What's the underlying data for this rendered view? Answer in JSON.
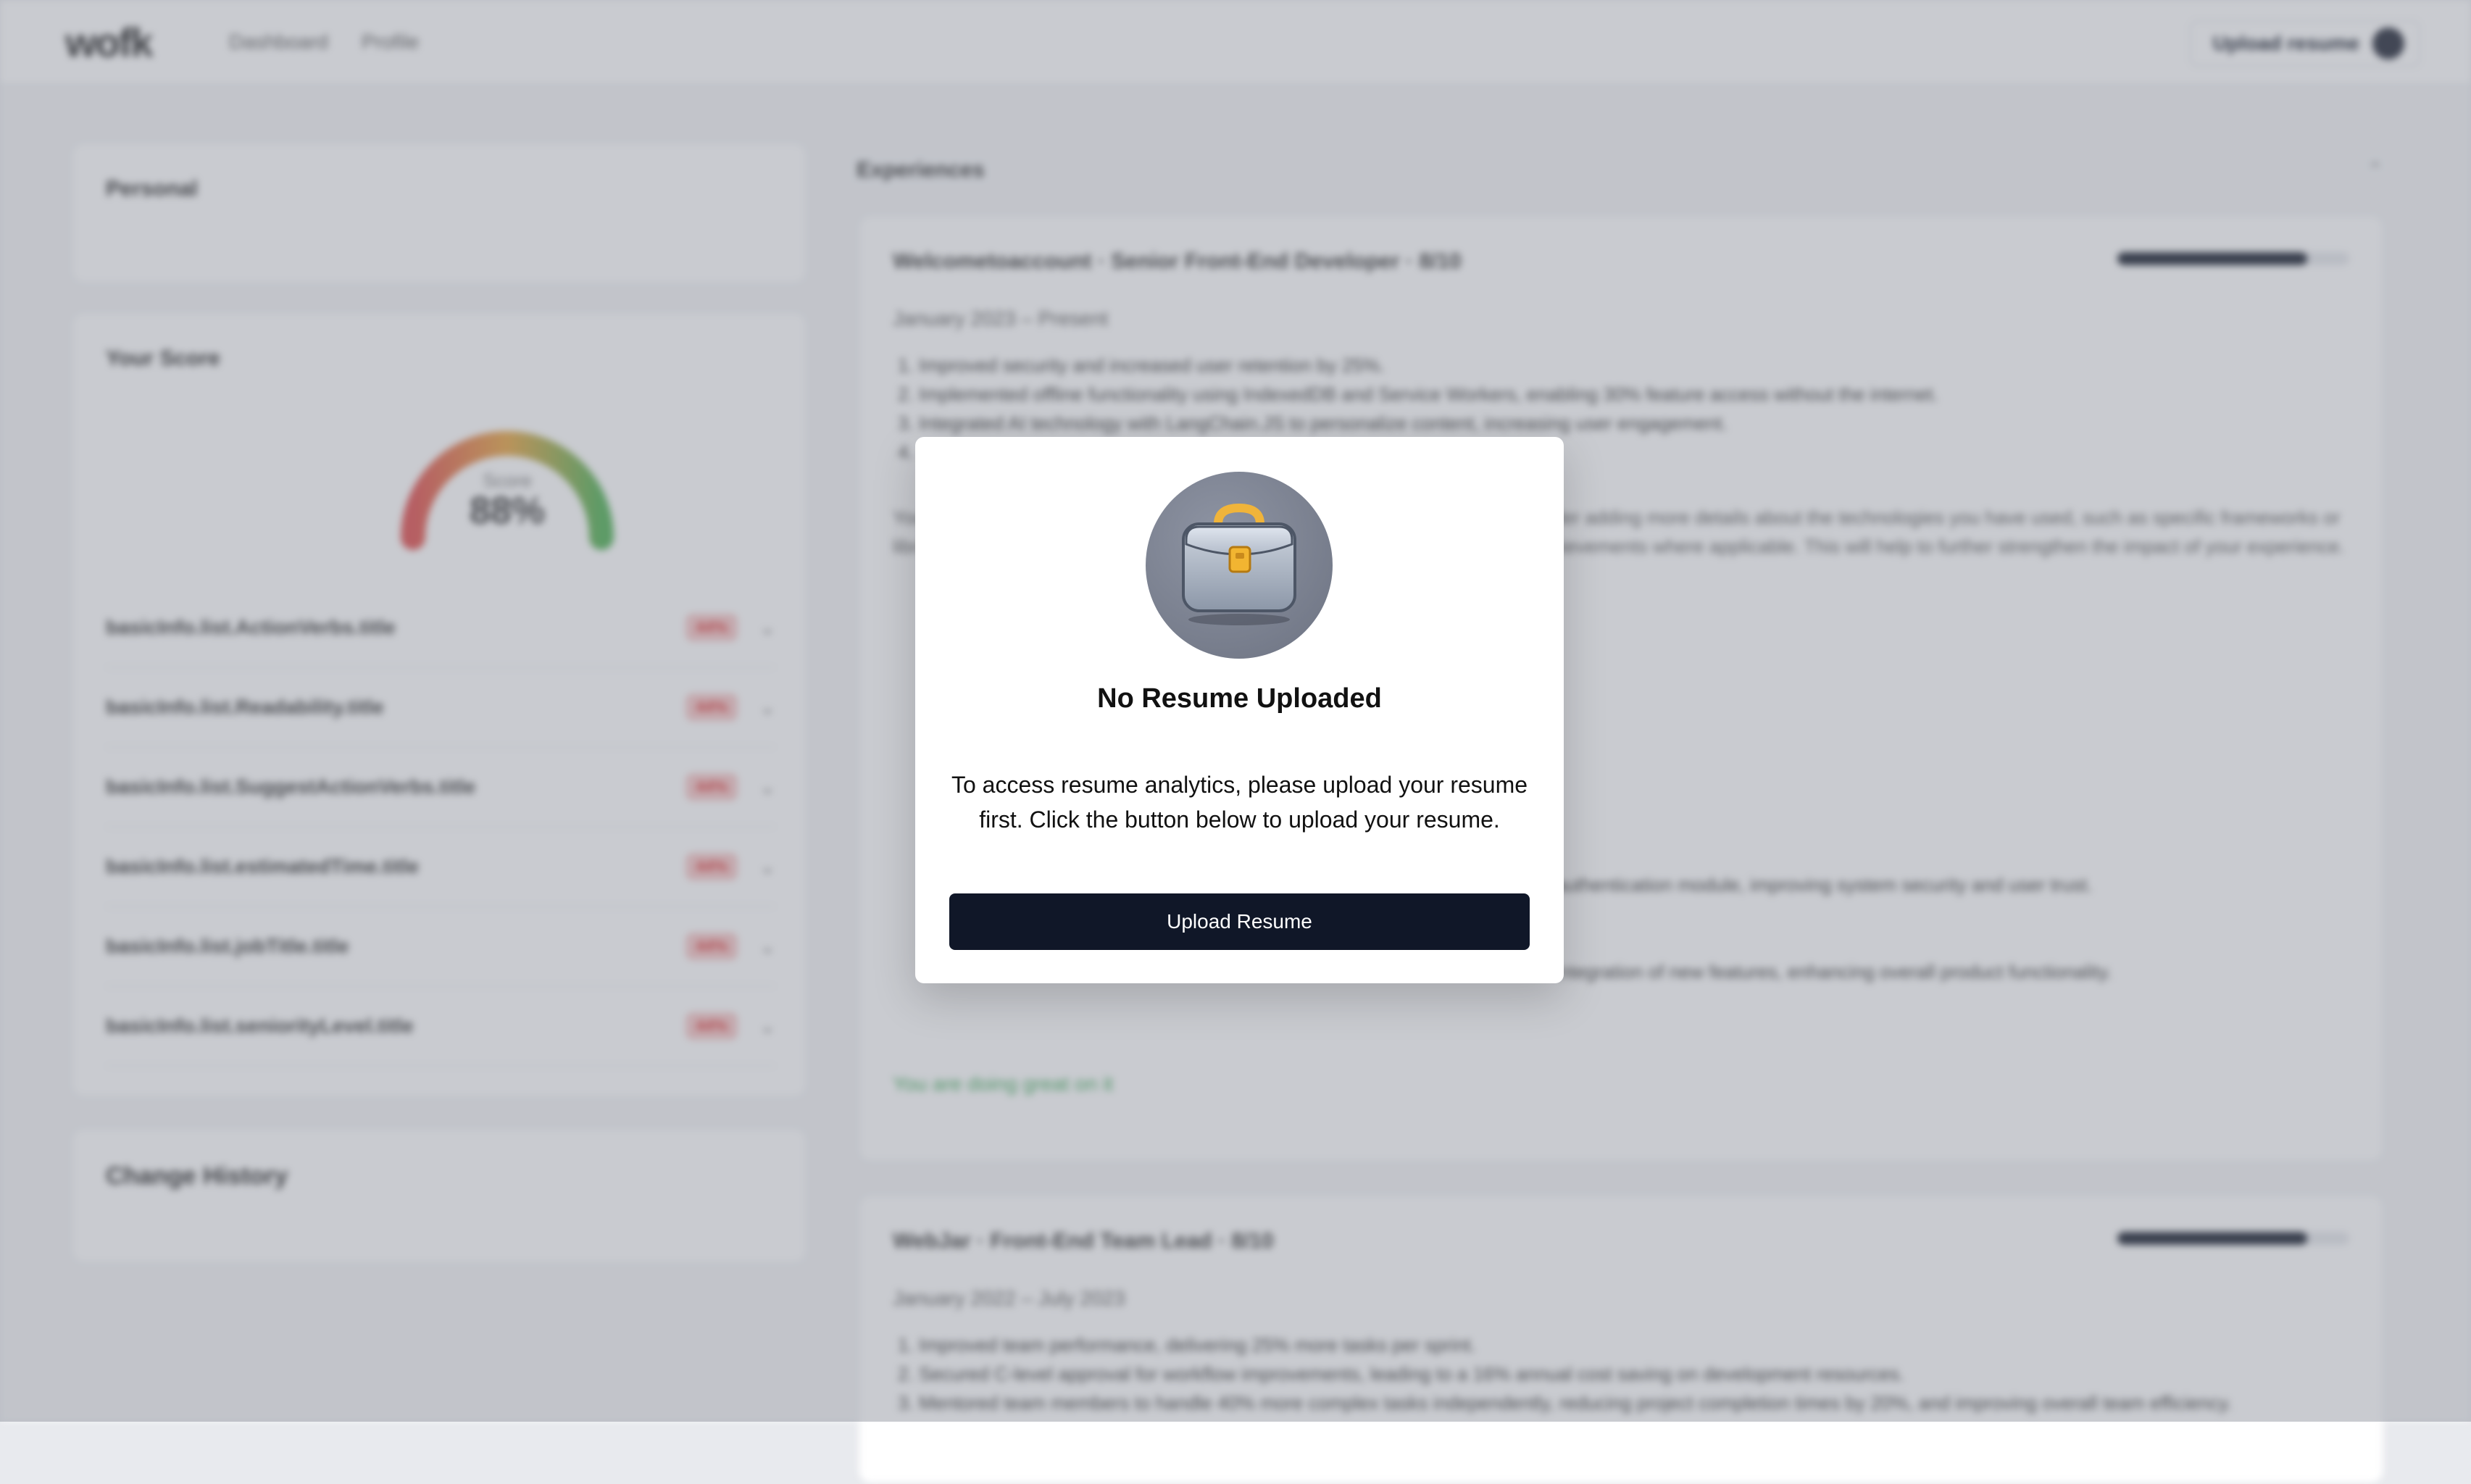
{
  "header": {
    "logo": "wofk",
    "nav": [
      "Dashboard",
      "Profile"
    ],
    "upload_label": "Upload resume"
  },
  "left": {
    "personal_title": "Personal",
    "score_title": "Your Score",
    "gauge_label": "Score",
    "gauge_value": "88%",
    "score_rows": [
      {
        "name": "basicInfo.list.ActionVerbs.title",
        "badge": "44%"
      },
      {
        "name": "basicInfo.list.Readability.title",
        "badge": "44%"
      },
      {
        "name": "basicInfo.list.SuggestActionVerbs.title",
        "badge": "44%"
      },
      {
        "name": "basicInfo.list.estimatedTime.title",
        "badge": "44%"
      },
      {
        "name": "basicInfo.list.jobTitle.title",
        "badge": "44%"
      },
      {
        "name": "basicInfo.list.seniorityLevel.title",
        "badge": "44%"
      }
    ],
    "history_title": "Change History"
  },
  "experiences": {
    "heading": "Experiences",
    "items": [
      {
        "title": "Welcometoaccount · Senior Front-End Developer · 8/10",
        "dates": "January 2023 – Present",
        "progress": 0.82,
        "bullets": [
          "Improved security and increased user retention by 25%.",
          "Implemented offline functionality using IndexedDB and Service Workers, enabling 30% feature access without the internet.",
          "Integrated AI technology with LangChain.JS to personalize content, increasing user engagement.",
          "..."
        ],
        "feedback": "Your experience is strong and highly relevant. To achieve a perfect score, consider adding more details about the technologies you have used, such as specific frameworks or libraries. Additionally, ensure that all bullet points are clear and quantify your achievements where applicable. This will help to further strengthen the impact of your experience.",
        "row_text_1": "(%).",
        "row_text_2": "authentication module, improving system security and user trust.",
        "row_text_3": "integration of new features, enhancing overall product functionality.",
        "good_note": "You are doing great on it"
      },
      {
        "title": "WebJar · Front-End Team Lead · 8/10",
        "dates": "January 2022 – July 2023",
        "progress": 0.82,
        "bullets": [
          "Improved team performance, delivering 25% more tasks per sprint.",
          "Secured C-level approval for workflow improvements, leading to a 16% annual cost saving on development resources.",
          "Mentored team members to handle 40% more complex tasks independently, reducing project completion times by 20%, and improving overall team efficiency."
        ]
      }
    ]
  },
  "modal": {
    "icon": "briefcase-icon",
    "title": "No Resume Uploaded",
    "description": "To access resume analytics, please upload your resume first. Click the button below to upload your resume.",
    "button_label": "Upload Resume"
  }
}
